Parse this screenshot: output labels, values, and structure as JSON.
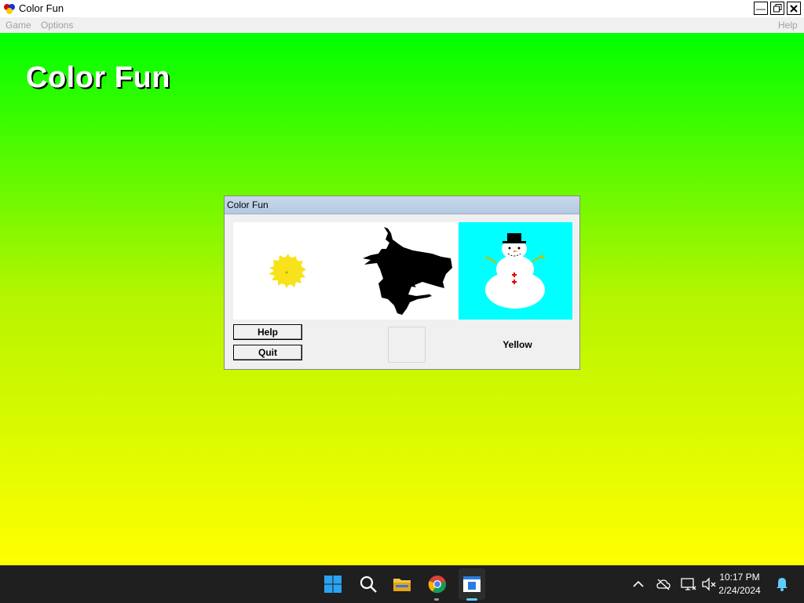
{
  "window": {
    "title": "Color Fun",
    "menu": [
      "Game",
      "Options"
    ],
    "help_menu": "Help"
  },
  "main": {
    "heading": "Color Fun",
    "colors": {
      "top": "#00ff00",
      "bottom": "#ffff00"
    }
  },
  "dialog": {
    "title": "Color Fun",
    "help_button": "Help",
    "quit_button": "Quit",
    "color_name": "Yellow",
    "pictures": [
      "sun",
      "witch-silhouette",
      "snowman"
    ]
  },
  "taskbar": {
    "time": "10:17 PM",
    "date": "2/24/2024",
    "icons": [
      "windows-start-icon",
      "search-icon",
      "file-explorer-icon",
      "chrome-icon",
      "color-fun-app-icon"
    ]
  }
}
